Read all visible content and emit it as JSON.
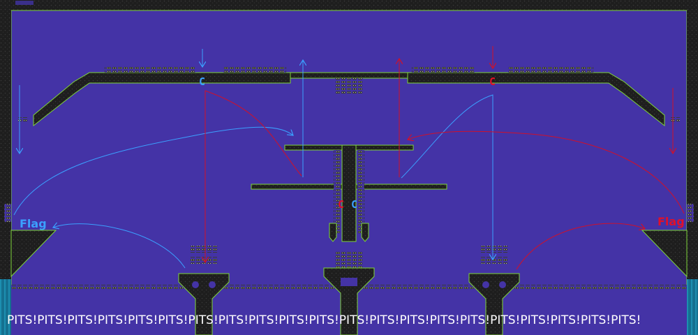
{
  "map": {
    "bottom_banner": "PITS!PITS!PITS!PITS!PITS!PITS!PITS!PITS!PITS!PITS!PITS!PITS!PITS!PITS!PITS!PITS!PITS!PITS!PITS!PITS!PITS!",
    "blue_base": {
      "label": "Flag",
      "color": "#3ba0ff"
    },
    "red_base": {
      "label": "Flag",
      "color": "#e0102a"
    },
    "spawn_markers": [
      {
        "label": "C",
        "team": "blue",
        "color": "#3ba0ff"
      },
      {
        "label": "C",
        "team": "red",
        "color": "#e0102a"
      },
      {
        "label": "C",
        "team": "red",
        "color": "#e0102a"
      },
      {
        "label": "C",
        "team": "blue",
        "color": "#3ba0ff"
      }
    ],
    "colors": {
      "background": "#4433a6",
      "solid_tile": "#1f1f1f",
      "tile_outline": "#7fd43a",
      "water": "#1a7ea0",
      "blue_route": "#3ba0ff",
      "red_route": "#d0102a",
      "banner_text": "#ffffff"
    }
  }
}
